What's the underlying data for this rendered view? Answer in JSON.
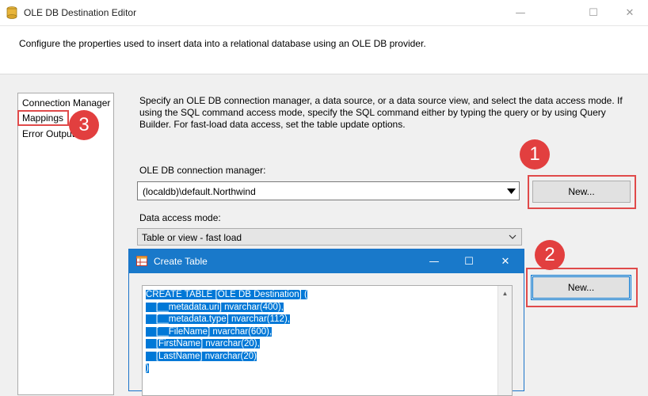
{
  "window": {
    "title": "OLE DB Destination Editor",
    "controls": {
      "minimize": "—",
      "maximize": "☐",
      "close": "✕"
    }
  },
  "header": {
    "description": "Configure the properties used to insert data into a relational database using an OLE DB provider."
  },
  "nav": {
    "items": [
      {
        "label": "Connection Manager"
      },
      {
        "label": "Mappings"
      },
      {
        "label": "Error Output"
      }
    ]
  },
  "main": {
    "description": "Specify an OLE DB connection manager, a data source, or a data source view, and select the data access mode. If using the SQL command access mode, specify the SQL command either by typing the query or by using Query Builder. For fast-load data access, set the table update options.",
    "connection_manager_label": "OLE DB connection manager:",
    "connection_manager_value": "(localdb)\\default.Northwind",
    "data_access_mode_label": "Data access mode:",
    "data_access_mode_value": "Table or view - fast load",
    "new_button_1": "New...",
    "new_button_2": "New..."
  },
  "badges": {
    "one": "1",
    "two": "2",
    "three": "3"
  },
  "create_table": {
    "title": "Create Table",
    "controls": {
      "minimize": "—",
      "maximize": "☐",
      "close": "✕"
    },
    "sql_lines": [
      "CREATE TABLE [OLE DB Destination] (",
      "    [__metadata.uri] nvarchar(400),",
      "    [__metadata.type] nvarchar(112),",
      "    [__FileName] nvarchar(600),",
      "    [FirstName] nvarchar(20),",
      "    [LastName] nvarchar(20)",
      ")"
    ]
  },
  "colors": {
    "accent": "#0078d7",
    "dialog_titlebar": "#1979ca",
    "highlight_red": "#e04a4a",
    "badge_red": "#e23f3f"
  }
}
